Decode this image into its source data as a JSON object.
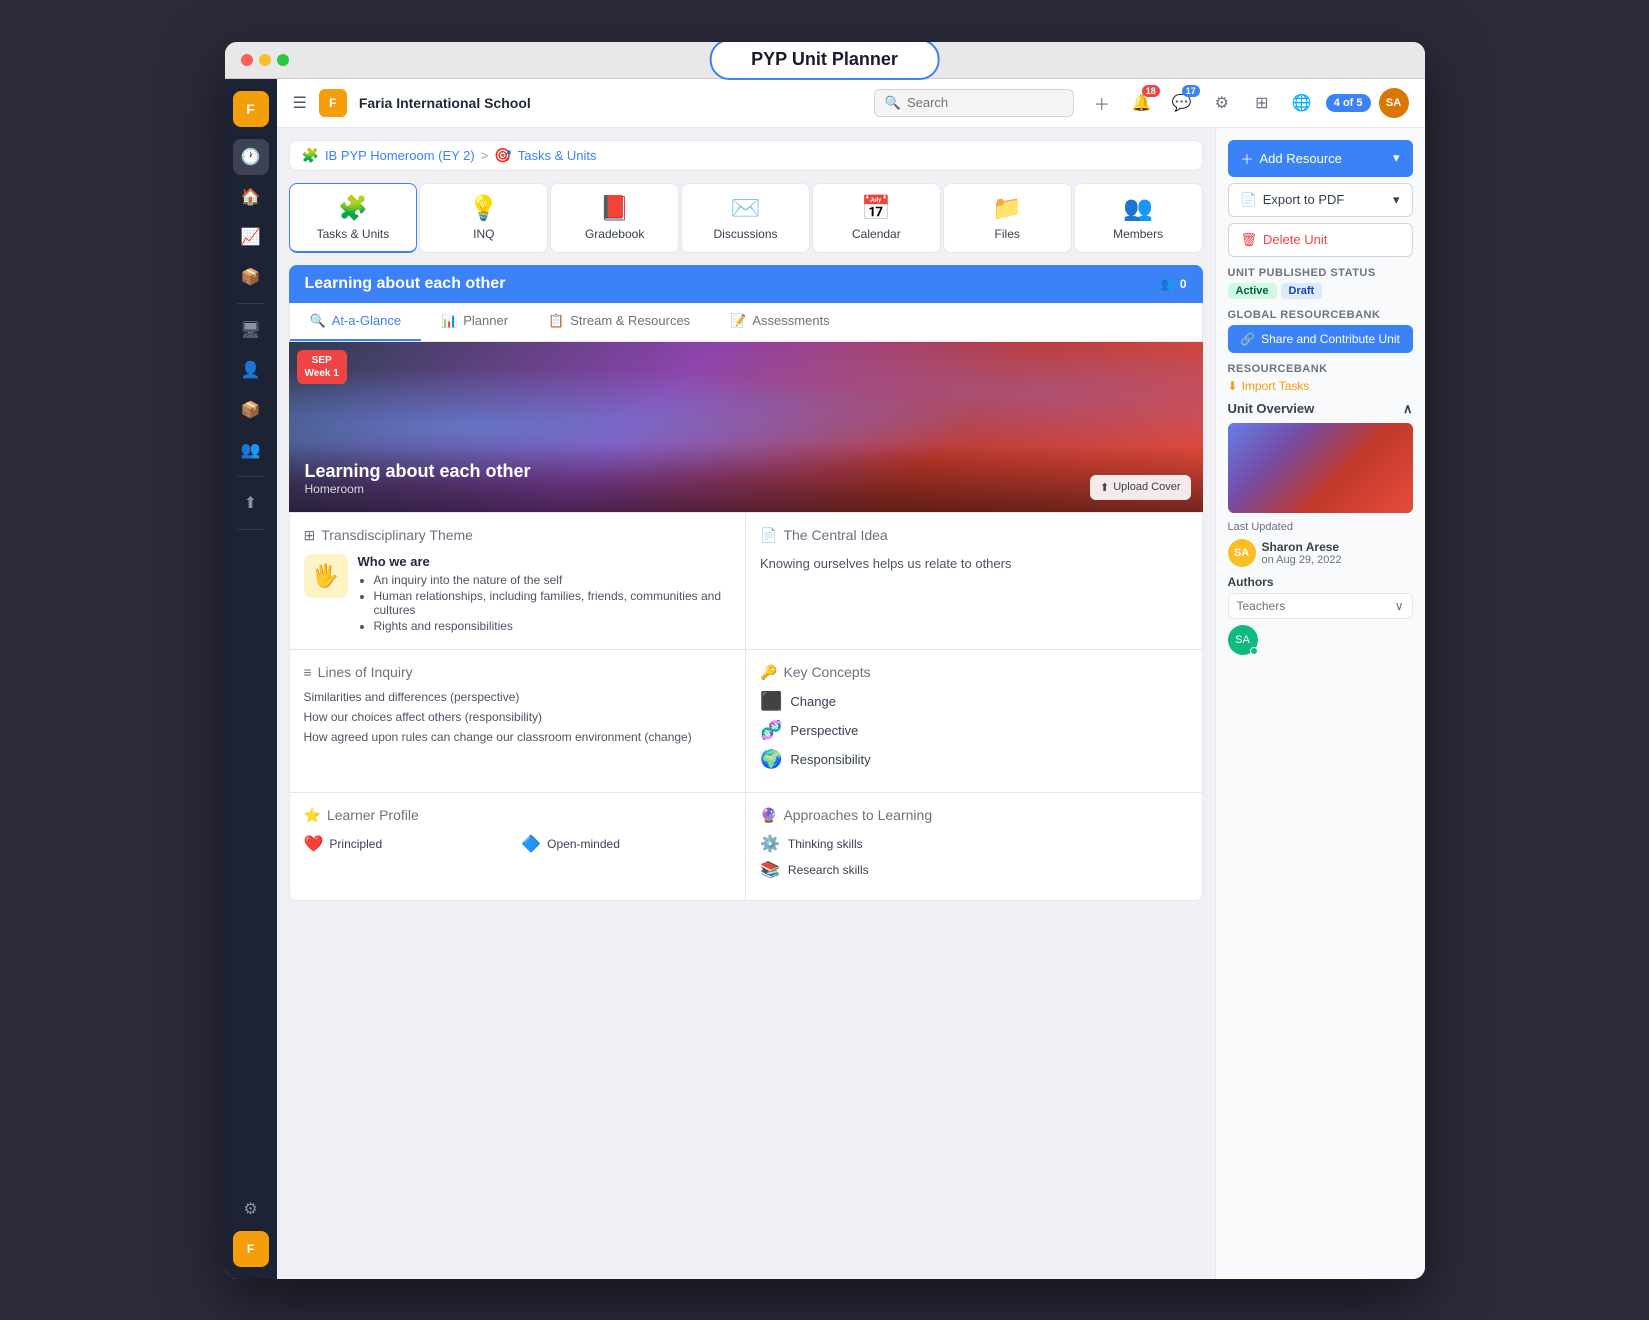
{
  "app": {
    "title": "PYP Unit Planner",
    "school": "Faria International School"
  },
  "header": {
    "search_placeholder": "Search",
    "notification_count": "18",
    "message_count": "17",
    "user_count": "4 of 5"
  },
  "breadcrumb": {
    "part1": "IB PYP Homeroom (EY 2)",
    "separator": ">",
    "part2": "Tasks & Units"
  },
  "nav_items": [
    {
      "label": "Tasks & Units",
      "icon": "🧩",
      "active": true
    },
    {
      "label": "INQ",
      "icon": "💡"
    },
    {
      "label": "Gradebook",
      "icon": "📕"
    },
    {
      "label": "Discussions",
      "icon": "✉️"
    },
    {
      "label": "Calendar",
      "icon": "📅"
    },
    {
      "label": "Files",
      "icon": "📁"
    },
    {
      "label": "Members",
      "icon": "👥"
    }
  ],
  "unit": {
    "title": "Learning about each other",
    "member_count": "0",
    "subject": "Homeroom"
  },
  "sub_tabs": [
    {
      "label": "At-a-Glance",
      "icon": "🔍",
      "active": true
    },
    {
      "label": "Planner",
      "icon": "📊"
    },
    {
      "label": "Stream & Resources",
      "icon": "📋"
    },
    {
      "label": "Assessments",
      "icon": "📝"
    }
  ],
  "cover": {
    "title": "Learning about each other",
    "subtitle": "Homeroom",
    "sep_label": "SEP\nWeek 1",
    "upload_btn": "Upload Cover"
  },
  "transdisciplinary": {
    "section_label": "Transdisciplinary Theme",
    "icon": "🖐",
    "theme_title": "Who we are",
    "points": [
      "An inquiry into the nature of the self",
      "Human relationships, including families, friends, communities and cultures",
      "Rights and responsibilities"
    ]
  },
  "central_idea": {
    "section_label": "The Central Idea",
    "text": "Knowing ourselves helps us relate to others"
  },
  "lines_of_inquiry": {
    "section_label": "Lines of Inquiry",
    "items": [
      "Similarities and differences (perspective)",
      "How our choices affect others (responsibility)",
      "How agreed upon rules can change our classroom environment (change)"
    ]
  },
  "key_concepts": {
    "section_label": "Key Concepts",
    "items": [
      {
        "label": "Change",
        "icon": "⬛"
      },
      {
        "label": "Perspective",
        "icon": "🧬"
      },
      {
        "label": "Responsibility",
        "icon": "🌍"
      }
    ]
  },
  "learner_profile": {
    "section_label": "Learner Profile",
    "items": [
      {
        "label": "Principled",
        "icon": "❤️"
      },
      {
        "label": "Open-minded",
        "icon": "🔷"
      }
    ]
  },
  "atl": {
    "section_label": "Approaches to Learning",
    "items": [
      {
        "label": "Thinking skills",
        "icon": "⚙️"
      },
      {
        "label": "Research skills",
        "icon": "📚"
      }
    ]
  },
  "sidebar": {
    "add_resource_label": "Add Resource",
    "export_pdf_label": "Export to PDF",
    "delete_unit_label": "Delete Unit",
    "published_status_label": "Unit Published Status",
    "active_label": "Active",
    "draft_label": "Draft",
    "global_resource_label": "Global ResourceBank",
    "share_btn_label": "Share and Contribute Unit",
    "resource_bank_label": "ResourceBank",
    "import_tasks_label": "Import Tasks",
    "unit_overview_label": "Unit Overview",
    "last_updated_label": "Last Updated",
    "updater_name": "Sharon Arese",
    "updater_date": "on Aug 29, 2022",
    "authors_label": "Authors",
    "teachers_label": "Teachers"
  }
}
